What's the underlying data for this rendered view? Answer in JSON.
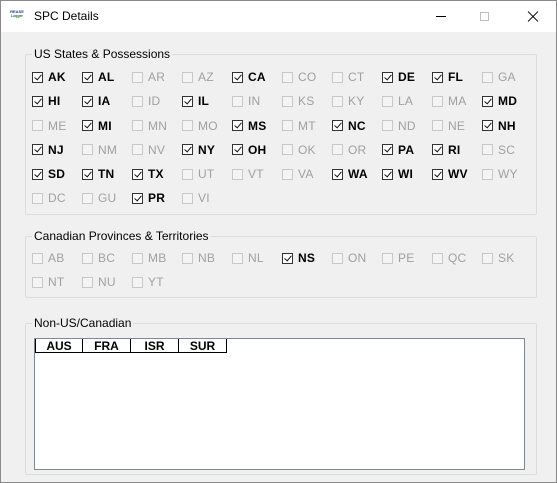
{
  "window": {
    "title": "SPC Details",
    "icon_text_line1": "REASE",
    "icon_text_line2": "Logger"
  },
  "us_group": {
    "title": "US States & Possessions",
    "items": [
      {
        "label": "AK",
        "checked": true,
        "enabled": true
      },
      {
        "label": "AL",
        "checked": true,
        "enabled": true
      },
      {
        "label": "AR",
        "checked": false,
        "enabled": false
      },
      {
        "label": "AZ",
        "checked": false,
        "enabled": false
      },
      {
        "label": "CA",
        "checked": true,
        "enabled": true
      },
      {
        "label": "CO",
        "checked": false,
        "enabled": false
      },
      {
        "label": "CT",
        "checked": false,
        "enabled": false
      },
      {
        "label": "DE",
        "checked": true,
        "enabled": true
      },
      {
        "label": "FL",
        "checked": true,
        "enabled": true
      },
      {
        "label": "GA",
        "checked": false,
        "enabled": false
      },
      {
        "label": "HI",
        "checked": true,
        "enabled": true
      },
      {
        "label": "IA",
        "checked": true,
        "enabled": true
      },
      {
        "label": "ID",
        "checked": false,
        "enabled": false
      },
      {
        "label": "IL",
        "checked": true,
        "enabled": true
      },
      {
        "label": "IN",
        "checked": false,
        "enabled": false
      },
      {
        "label": "KS",
        "checked": false,
        "enabled": false
      },
      {
        "label": "KY",
        "checked": false,
        "enabled": false
      },
      {
        "label": "LA",
        "checked": false,
        "enabled": false
      },
      {
        "label": "MA",
        "checked": false,
        "enabled": false
      },
      {
        "label": "MD",
        "checked": true,
        "enabled": true
      },
      {
        "label": "ME",
        "checked": false,
        "enabled": false
      },
      {
        "label": "MI",
        "checked": true,
        "enabled": true
      },
      {
        "label": "MN",
        "checked": false,
        "enabled": false
      },
      {
        "label": "MO",
        "checked": false,
        "enabled": false
      },
      {
        "label": "MS",
        "checked": true,
        "enabled": true
      },
      {
        "label": "MT",
        "checked": false,
        "enabled": false
      },
      {
        "label": "NC",
        "checked": true,
        "enabled": true
      },
      {
        "label": "ND",
        "checked": false,
        "enabled": false
      },
      {
        "label": "NE",
        "checked": false,
        "enabled": false
      },
      {
        "label": "NH",
        "checked": true,
        "enabled": true
      },
      {
        "label": "NJ",
        "checked": true,
        "enabled": true
      },
      {
        "label": "NM",
        "checked": false,
        "enabled": false
      },
      {
        "label": "NV",
        "checked": false,
        "enabled": false
      },
      {
        "label": "NY",
        "checked": true,
        "enabled": true
      },
      {
        "label": "OH",
        "checked": true,
        "enabled": true
      },
      {
        "label": "OK",
        "checked": false,
        "enabled": false
      },
      {
        "label": "OR",
        "checked": false,
        "enabled": false
      },
      {
        "label": "PA",
        "checked": true,
        "enabled": true
      },
      {
        "label": "RI",
        "checked": true,
        "enabled": true
      },
      {
        "label": "SC",
        "checked": false,
        "enabled": false
      },
      {
        "label": "SD",
        "checked": true,
        "enabled": true
      },
      {
        "label": "TN",
        "checked": true,
        "enabled": true
      },
      {
        "label": "TX",
        "checked": true,
        "enabled": true
      },
      {
        "label": "UT",
        "checked": false,
        "enabled": false
      },
      {
        "label": "VT",
        "checked": false,
        "enabled": false
      },
      {
        "label": "VA",
        "checked": false,
        "enabled": false
      },
      {
        "label": "WA",
        "checked": true,
        "enabled": true
      },
      {
        "label": "WI",
        "checked": true,
        "enabled": true
      },
      {
        "label": "WV",
        "checked": true,
        "enabled": true
      },
      {
        "label": "WY",
        "checked": false,
        "enabled": false
      },
      {
        "label": "DC",
        "checked": false,
        "enabled": false
      },
      {
        "label": "GU",
        "checked": false,
        "enabled": false
      },
      {
        "label": "PR",
        "checked": true,
        "enabled": true
      },
      {
        "label": "VI",
        "checked": false,
        "enabled": false
      }
    ]
  },
  "ca_group": {
    "title": "Canadian Provinces & Territories",
    "items": [
      {
        "label": "AB",
        "checked": false,
        "enabled": false
      },
      {
        "label": "BC",
        "checked": false,
        "enabled": false
      },
      {
        "label": "MB",
        "checked": false,
        "enabled": false
      },
      {
        "label": "NB",
        "checked": false,
        "enabled": false
      },
      {
        "label": "NL",
        "checked": false,
        "enabled": false
      },
      {
        "label": "NS",
        "checked": true,
        "enabled": true
      },
      {
        "label": "ON",
        "checked": false,
        "enabled": false
      },
      {
        "label": "PE",
        "checked": false,
        "enabled": false
      },
      {
        "label": "QC",
        "checked": false,
        "enabled": false
      },
      {
        "label": "SK",
        "checked": false,
        "enabled": false
      },
      {
        "label": "NT",
        "checked": false,
        "enabled": false
      },
      {
        "label": "NU",
        "checked": false,
        "enabled": false
      },
      {
        "label": "YT",
        "checked": false,
        "enabled": false
      }
    ]
  },
  "other_group": {
    "title": "Non-US/Canadian",
    "columns": [
      "AUS",
      "FRA",
      "ISR",
      "SUR"
    ]
  }
}
